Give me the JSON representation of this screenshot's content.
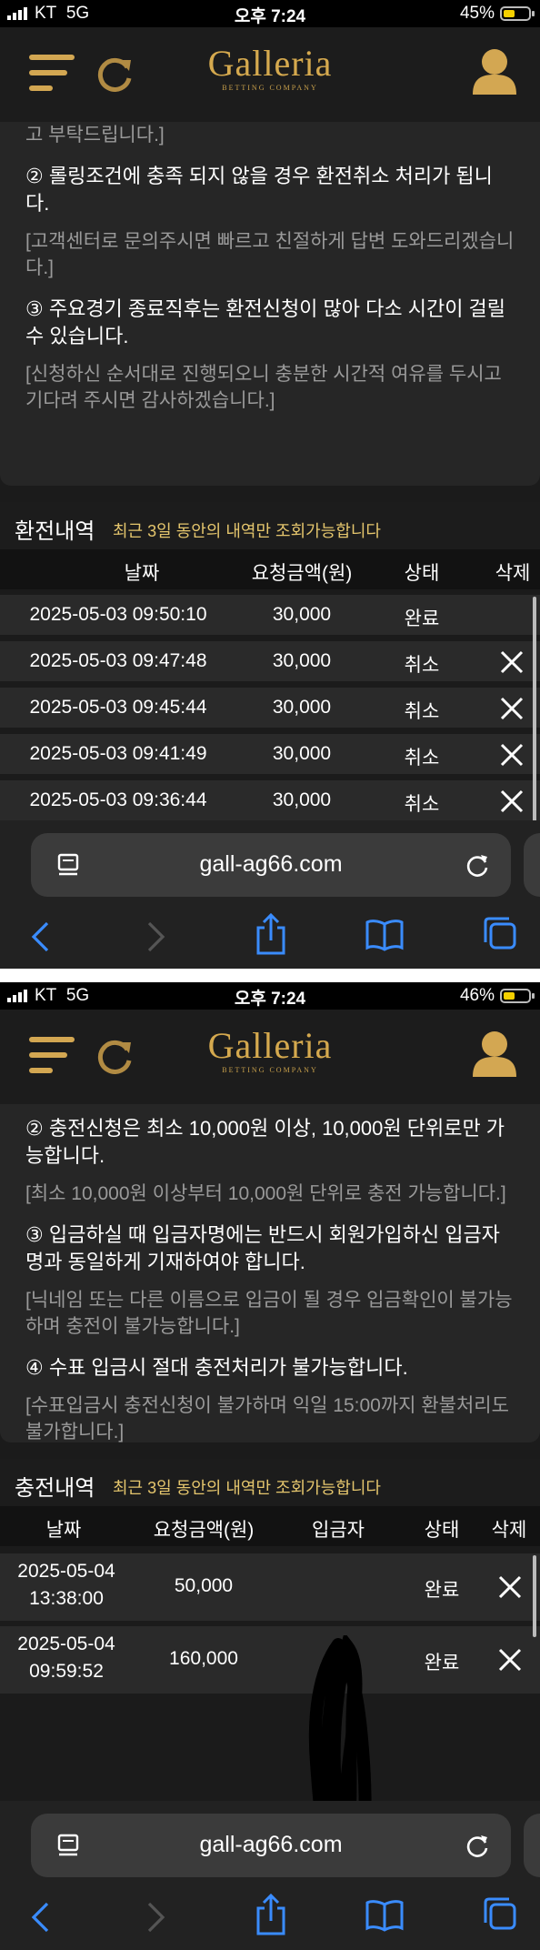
{
  "screens": [
    {
      "status": {
        "carrier": "KT",
        "network": "5G",
        "time": "오후 7:24",
        "battery": "45%",
        "battery_level": 0.45
      },
      "header": {
        "logo": "Galleria",
        "tagline": "BETTING COMPANY"
      },
      "notice": {
        "lines": [
          {
            "text": "고 부탁드립니다.]",
            "kind": "sub"
          },
          {
            "text": "② 롤링조건에 충족 되지 않을 경우 환전취소 처리가 됩니다.",
            "kind": "main"
          },
          {
            "text": "[고객센터로 문의주시면 빠르고 친절하게 답변 도와드리겠습니다.]",
            "kind": "sub"
          },
          {
            "text": "③ 주요경기 종료직후는 환전신청이 많아 다소 시간이 걸릴 수 있습니다.",
            "kind": "main"
          },
          {
            "text": "[신청하신 순서대로 진행되오니 충분한 시간적 여유를 두시고 기다려 주시면 감사하겠습니다.]",
            "kind": "sub"
          }
        ]
      },
      "history": {
        "title": "환전내역",
        "hint": "최근 3일 동안의 내역만 조회가능합니다",
        "columns": [
          "날짜",
          "요청금액(원)",
          "상태",
          "삭제"
        ],
        "rows": [
          {
            "date": "2025-05-03 09:50:10",
            "amount": "30,000",
            "status": "완료",
            "deletable": false
          },
          {
            "date": "2025-05-03 09:47:48",
            "amount": "30,000",
            "status": "취소",
            "deletable": true
          },
          {
            "date": "2025-05-03 09:45:44",
            "amount": "30,000",
            "status": "취소",
            "deletable": true
          },
          {
            "date": "2025-05-03 09:41:49",
            "amount": "30,000",
            "status": "취소",
            "deletable": true
          },
          {
            "date": "2025-05-03 09:36:44",
            "amount": "30,000",
            "status": "취소",
            "deletable": true
          }
        ]
      },
      "browser": {
        "url": "gall-ag66.com"
      }
    },
    {
      "status": {
        "carrier": "KT",
        "network": "5G",
        "time": "오후 7:24",
        "battery": "46%",
        "battery_level": 0.46
      },
      "header": {
        "logo": "Galleria",
        "tagline": "BETTING COMPANY"
      },
      "notice": {
        "lines": [
          {
            "text": "② 충전신청은 최소 10,000원 이상, 10,000원 단위로만 가능합니다.",
            "kind": "main"
          },
          {
            "text": "[최소 10,000원 이상부터 10,000원 단위로 충전 가능합니다.]",
            "kind": "sub"
          },
          {
            "text": "③ 입금하실 때 입금자명에는 반드시 회원가입하신 입금자명과 동일하게 기재하여야 합니다.",
            "kind": "main"
          },
          {
            "text": "[닉네임 또는 다른 이름으로 입금이 될 경우 입금확인이 불가능하며 충전이 불가능합니다.]",
            "kind": "sub"
          },
          {
            "text": "④ 수표 입금시 절대 충전처리가 불가능합니다.",
            "kind": "main"
          },
          {
            "text": "[수표입금시 충전신청이 불가하며 익일 15:00까지 환불처리도 불가합니다.]",
            "kind": "sub"
          }
        ]
      },
      "history": {
        "title": "충전내역",
        "hint": "최근 3일 동안의 내역만 조회가능합니다",
        "columns": [
          "날짜",
          "요청금액(원)",
          "입금자",
          "상태",
          "삭제"
        ],
        "rows": [
          {
            "date_day": "2025-05-04",
            "date_time": "13:38:00",
            "amount": "50,000",
            "depositor": "",
            "status": "완료",
            "deletable": true
          },
          {
            "date_day": "2025-05-04",
            "date_time": "09:59:52",
            "amount": "160,000",
            "depositor": "",
            "status": "완료",
            "deletable": true
          }
        ]
      },
      "browser": {
        "url": "gall-ag66.com"
      }
    }
  ],
  "colors": {
    "gold": "#d5a94e",
    "hint": "#e5c66d",
    "link_blue": "#3a8cff",
    "background": "#1b1b1b"
  },
  "icons": [
    "menu-icon",
    "refresh-icon",
    "user-icon",
    "delete-x-icon",
    "tabs-icon",
    "reload-icon",
    "back-icon",
    "forward-icon",
    "share-icon",
    "bookmarks-icon",
    "tab-overview-icon"
  ]
}
